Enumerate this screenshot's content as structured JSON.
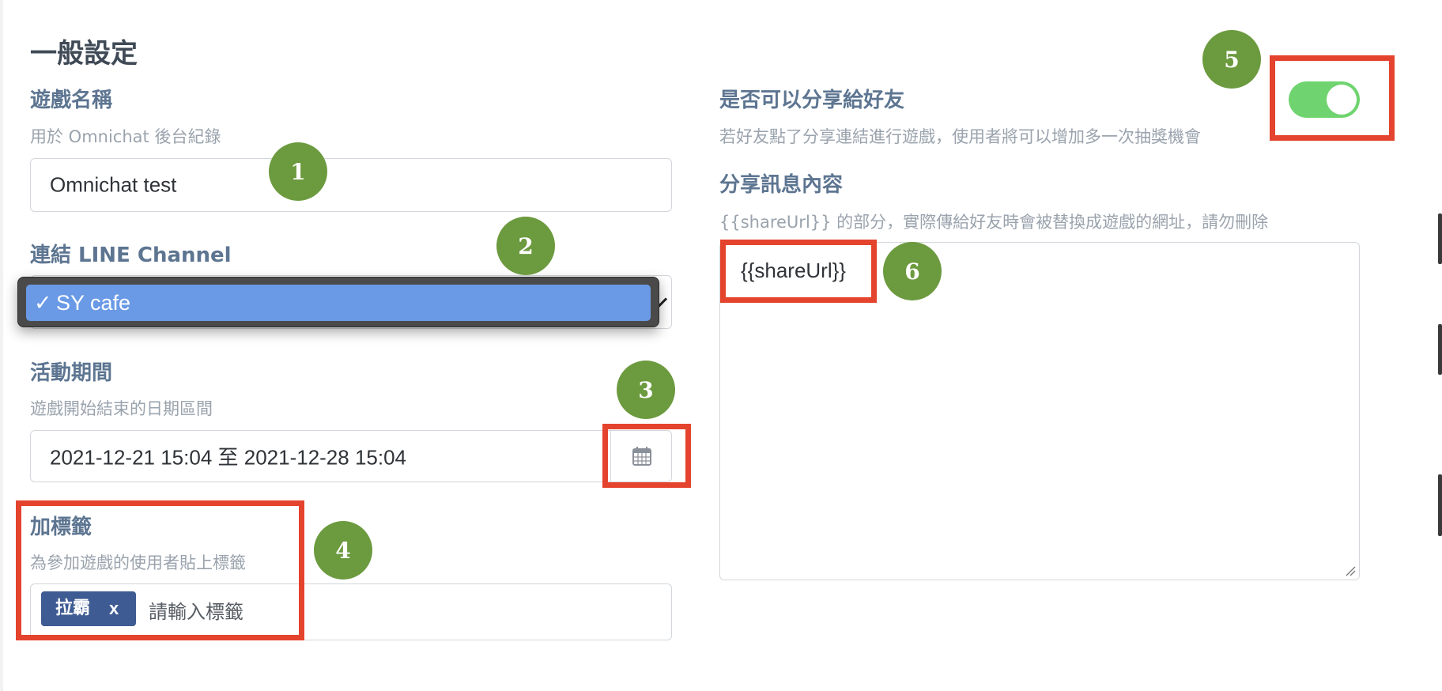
{
  "section": {
    "title": "一般設定"
  },
  "game_name": {
    "label": "遊戲名稱",
    "help": "用於 Omnichat 後台紀錄",
    "value": "Omnichat test"
  },
  "line_channel": {
    "label": "連結 LINE Channel",
    "selected_option": "SY cafe",
    "check_glyph": "✓"
  },
  "period": {
    "label": "活動期間",
    "help": "遊戲開始結束的日期區間",
    "value": "2021-12-21 15:04 至 2021-12-28 15:04",
    "icon": "calendar-icon"
  },
  "tags": {
    "label": "加標籤",
    "help": "為參加遊戲的使用者貼上標籤",
    "chips": [
      {
        "text": "拉霸",
        "remove": "x"
      }
    ],
    "placeholder": "請輸入標籤"
  },
  "share": {
    "label": "是否可以分享給好友",
    "help": "若好友點了分享連結進行遊戲，使用者將可以增加多一次抽獎機會",
    "enabled": true
  },
  "share_message": {
    "label": "分享訊息內容",
    "help": "{{shareUrl}} 的部分，實際傳給好友時會被替換成遊戲的網址，請勿刪除",
    "value": "{{shareUrl}}"
  },
  "markers": [
    "1",
    "2",
    "3",
    "4",
    "5",
    "6"
  ],
  "colors": {
    "annotation_red": "#e4432d",
    "marker_green": "#6c9a3f",
    "toggle_on": "#6fd46f",
    "tag_bg": "#3e5b93",
    "option_highlight": "#6a9ae6"
  }
}
